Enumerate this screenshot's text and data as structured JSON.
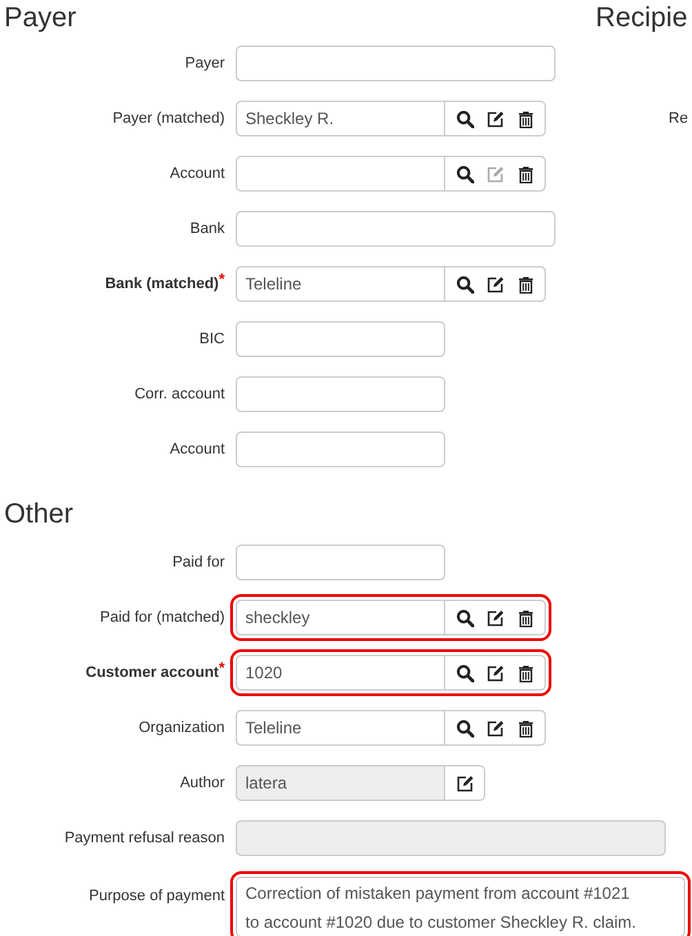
{
  "sections": [
    {
      "title": "Payer",
      "fields": [
        {
          "label": "Payer",
          "kind": "text",
          "required": false,
          "disabled": false,
          "highlighted": false
        },
        {
          "label": "Payer (matched)",
          "kind": "lookup",
          "value": "Sheckley R.",
          "required": false,
          "disabled": false,
          "highlighted": false,
          "edit_disabled": false
        },
        {
          "label": "Account",
          "kind": "lookup",
          "required": false,
          "disabled": false,
          "highlighted": false,
          "edit_disabled": true
        },
        {
          "label": "Bank",
          "kind": "text",
          "required": false,
          "disabled": false,
          "highlighted": false
        },
        {
          "label": "Bank (matched)",
          "kind": "lookup",
          "value": "Teleline",
          "required": true,
          "required_mark": "*",
          "disabled": false,
          "highlighted": false,
          "edit_disabled": false
        },
        {
          "label": "BIC",
          "kind": "short_text",
          "required": false,
          "disabled": false,
          "highlighted": false
        },
        {
          "label": "Corr. account",
          "kind": "short_text",
          "required": false,
          "disabled": false,
          "highlighted": false
        },
        {
          "label": "Account",
          "kind": "short_text",
          "required": false,
          "disabled": false,
          "highlighted": false
        }
      ]
    },
    {
      "title": "Other",
      "fields": [
        {
          "label": "Paid for",
          "kind": "short_text",
          "required": false,
          "disabled": false,
          "highlighted": false
        },
        {
          "label": "Paid for (matched)",
          "kind": "lookup",
          "value": "sheckley",
          "required": false,
          "disabled": false,
          "highlighted": true,
          "edit_disabled": false
        },
        {
          "label": "Customer account",
          "kind": "lookup",
          "value": "1020",
          "required": true,
          "required_mark": "*",
          "disabled": false,
          "highlighted": true,
          "edit_disabled": false
        },
        {
          "label": "Organization",
          "kind": "lookup",
          "value": "Teleline",
          "required": false,
          "disabled": false,
          "highlighted": false,
          "edit_disabled": false
        },
        {
          "label": "Author",
          "kind": "edit_only",
          "value": "latera",
          "required": false,
          "disabled": true,
          "highlighted": false
        },
        {
          "label": "Payment refusal reason",
          "kind": "long_text",
          "required": false,
          "disabled": true,
          "highlighted": false
        },
        {
          "label": "Purpose of payment",
          "kind": "textarea",
          "value": "Correction of mistaken payment from account #1021 to account #1020 due to customer Sheckley R. claim.",
          "required": false,
          "disabled": false,
          "highlighted": true
        }
      ]
    }
  ],
  "recipient_column": {
    "title": "Recipie",
    "row_labels": [
      "Re"
    ]
  }
}
